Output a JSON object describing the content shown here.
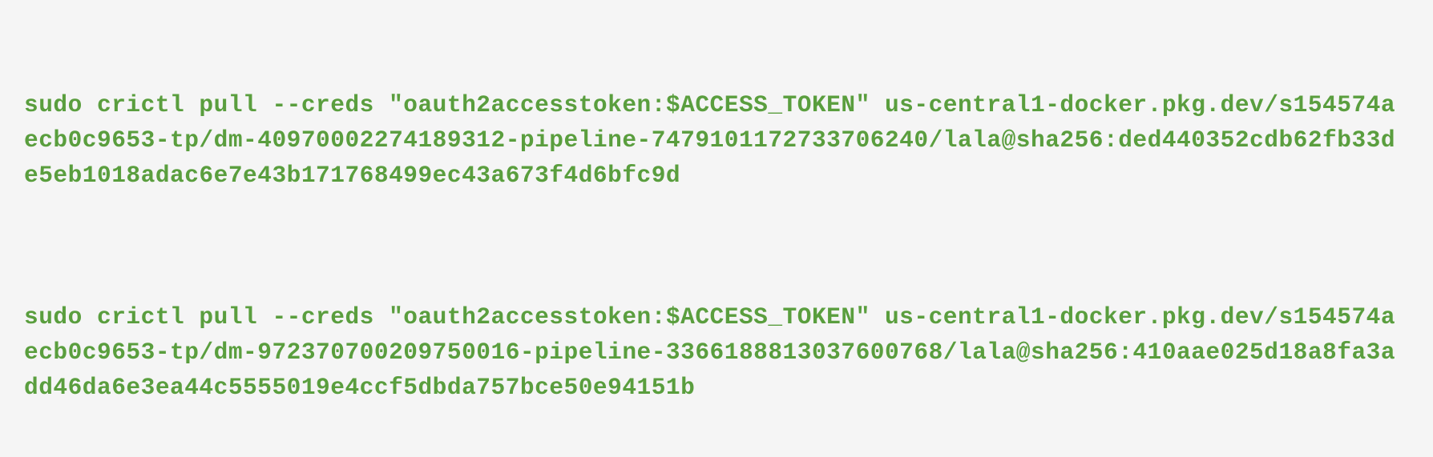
{
  "commands": [
    {
      "text": "sudo crictl pull --creds \"oauth2accesstoken:$ACCESS_TOKEN\" us-central1-docker.pkg.dev/s154574aecb0c9653-tp/dm-40970002274189312-pipeline-7479101172733706240/lala@sha256:ded440352cdb62fb33de5eb1018adac6e7e43b171768499ec43a673f4d6bfc9d"
    },
    {
      "text": "sudo crictl pull --creds \"oauth2accesstoken:$ACCESS_TOKEN\" us-central1-docker.pkg.dev/s154574aecb0c9653-tp/dm-972370700209750016-pipeline-3366188813037600768/lala@sha256:410aae025d18a8fa3add46da6e3ea44c5555019e4ccf5dbda757bce50e94151b"
    }
  ]
}
